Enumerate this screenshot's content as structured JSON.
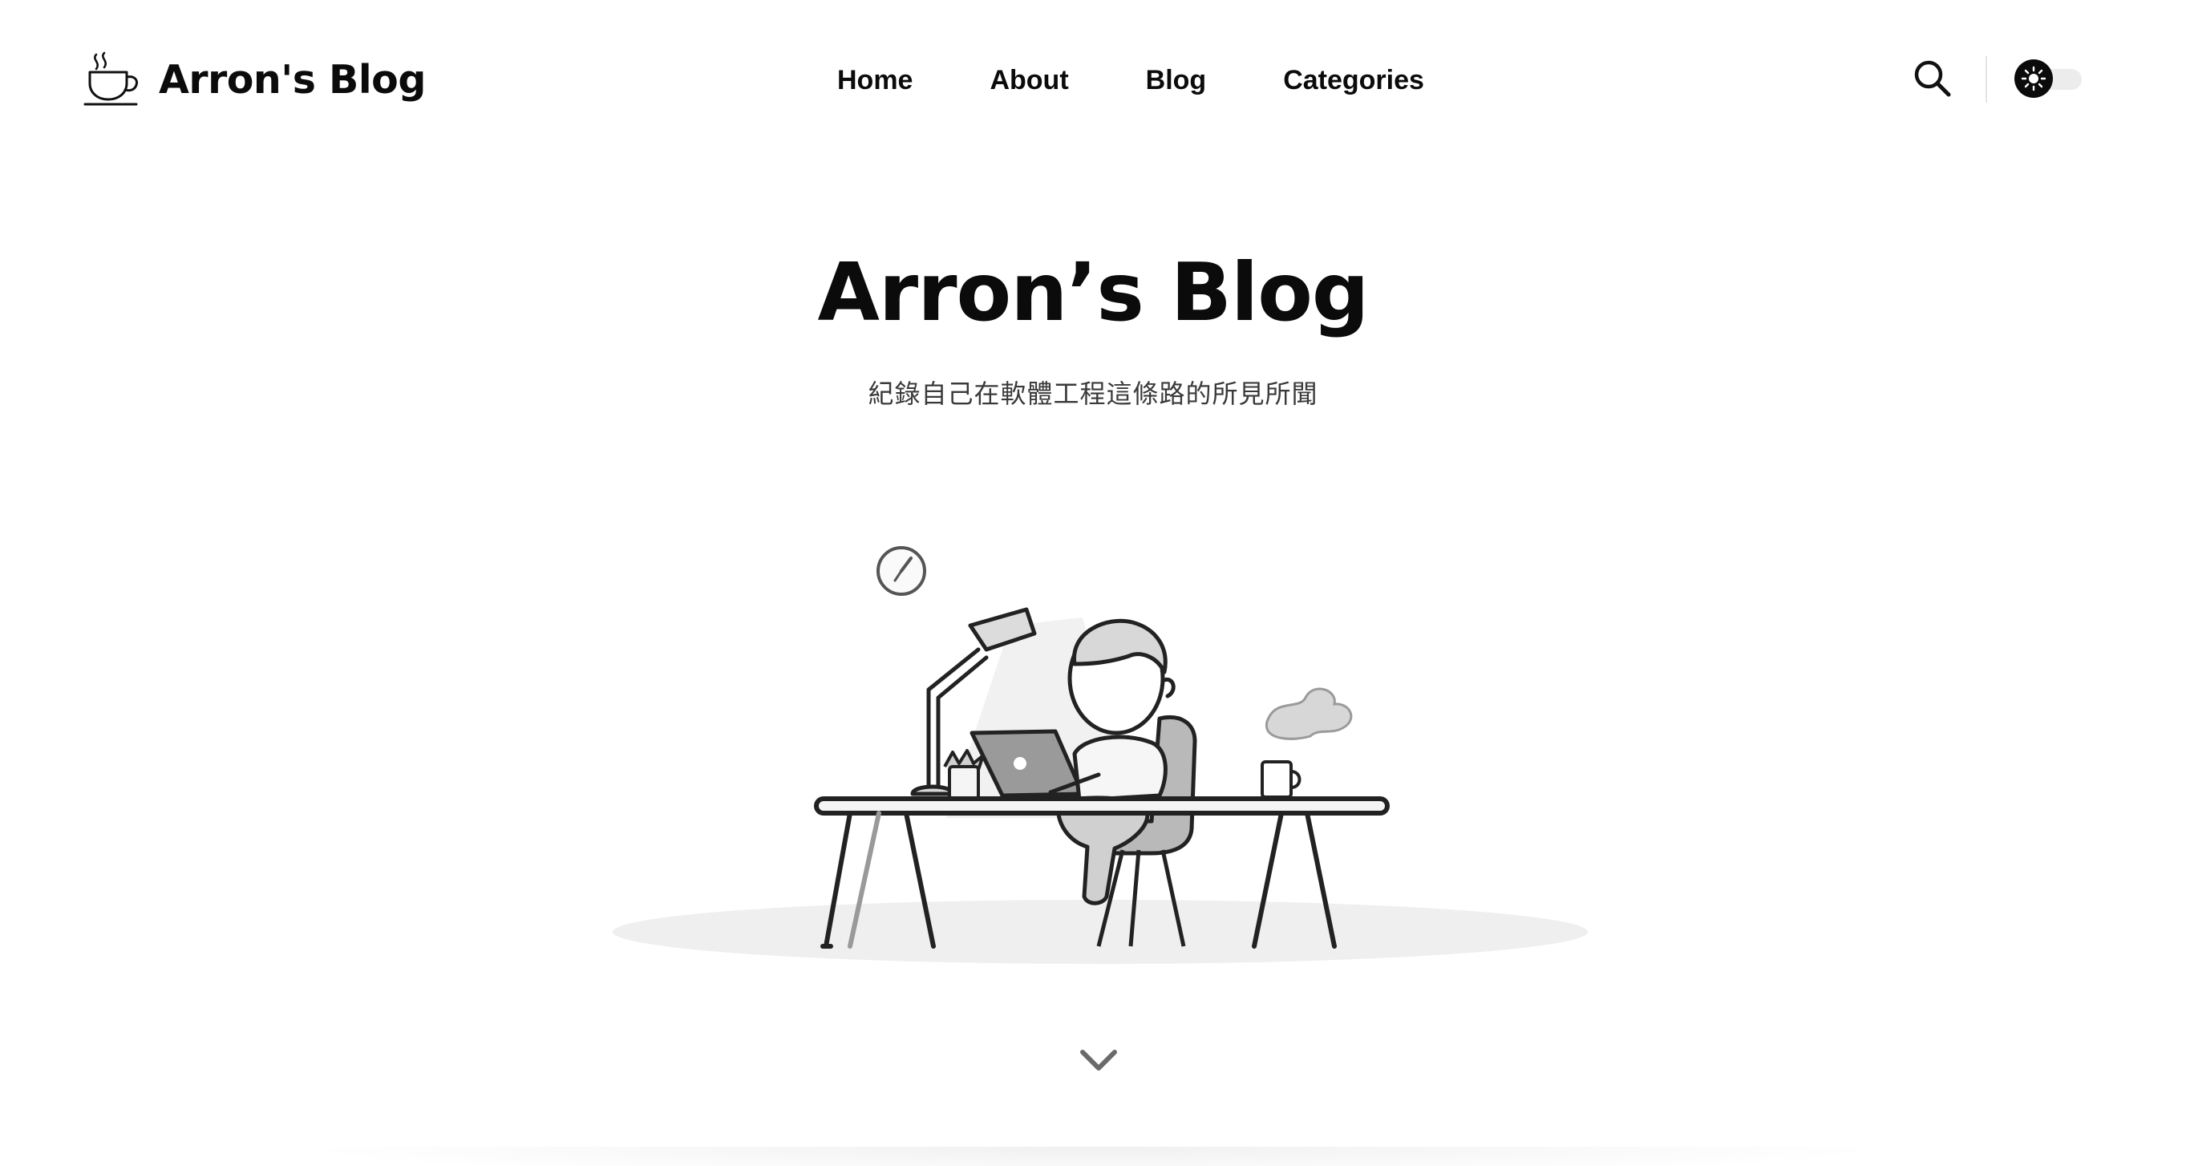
{
  "header": {
    "logo_text": "Arron's Blog",
    "logo_icon": "coffee-cup-icon",
    "nav": [
      {
        "label": "Home"
      },
      {
        "label": "About"
      },
      {
        "label": "Blog"
      },
      {
        "label": "Categories"
      }
    ],
    "search_icon": "search-icon",
    "theme_toggle_icon": "sun-icon",
    "theme_mode": "light"
  },
  "hero": {
    "title": "Arron’s Blog",
    "subtitle": "紀錄自己在軟體工程這條路的所見所聞",
    "illustration": "person-at-desk-with-laptop",
    "scroll_icon": "chevron-down-icon"
  },
  "colors": {
    "background": "#ffffff",
    "text": "#0b0b0b",
    "muted_text": "#3a3a3a",
    "toggle_track": "#ececec"
  }
}
